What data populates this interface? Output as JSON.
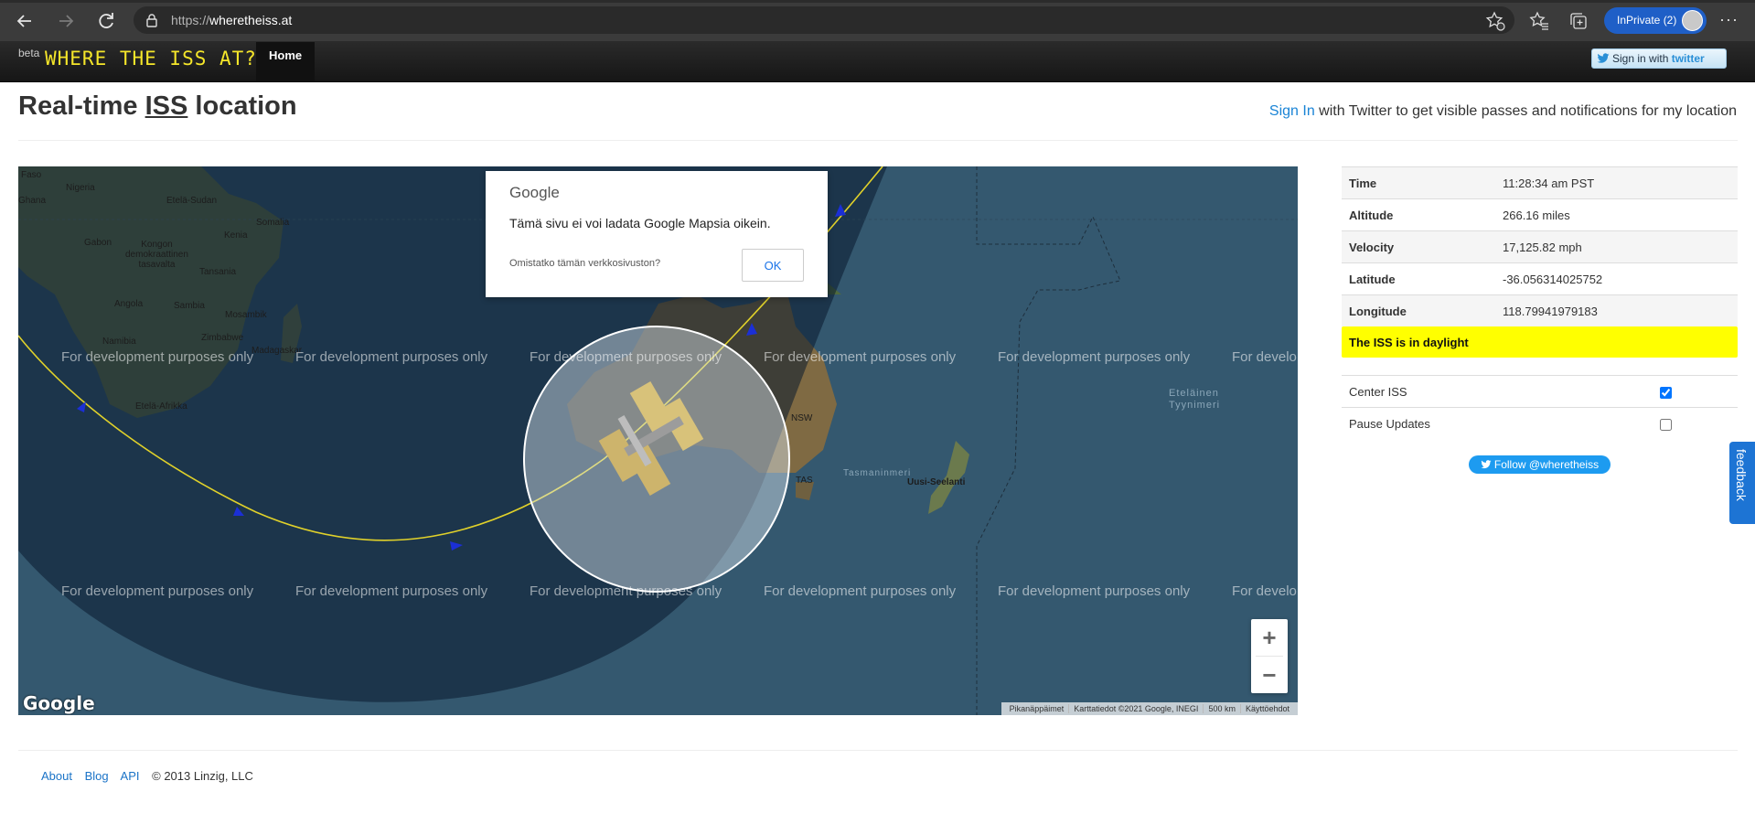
{
  "browser": {
    "url_prefix": "https://",
    "url_host": "wheretheiss.at",
    "inprivate_label": "InPrivate (2)",
    "icons": [
      "back-icon",
      "forward-icon",
      "refresh-icon",
      "lock-icon",
      "favorite-add-icon",
      "favorites-icon",
      "collections-icon",
      "more-icon"
    ]
  },
  "nav": {
    "beta": "beta",
    "brand": "WHERE THE ISS AT?",
    "home": "Home",
    "twitter_signin_prefix": "Sign in with",
    "twitter_signin_word": "twitter"
  },
  "header": {
    "title_pre": "Real-time ",
    "title_iss": "ISS",
    "title_post": " location",
    "signin_link": "Sign In",
    "signin_rest": " with Twitter to get visible passes and notifications for my location"
  },
  "map": {
    "watermark": "For development purposes only",
    "watermark_cut": "For develo",
    "dialog": {
      "brand": "Google",
      "message": "Tämä sivu ei voi ladata Google Mapsia oikein.",
      "own_question": "Omistatko tämän verkkosivuston?",
      "ok": "OK"
    },
    "labels": {
      "faso": "Faso",
      "nigeria": "Nigeria",
      "ghana": "Ghana",
      "ethiopia": "Etelä-Sudan",
      "somalia": "Somalia",
      "gabon": "Gabon",
      "kenia": "Kenia",
      "congo": "Kongon\ndemokraattinen\ntasavalta",
      "tansania": "Tansania",
      "angola": "Angola",
      "sambia": "Sambia",
      "mosambik": "Mosambik",
      "zimbabwe": "Zimbabwe",
      "namibia": "Namibia",
      "madagaskar": "Madagaskar",
      "safrica": "Etelä-Afrikka",
      "nsw": "NSW",
      "tas": "TAS",
      "nz": "Uusi-Seelanti",
      "pacific": "Eteläinen\nTyynimeri",
      "tasman": "Tasmaninmeri"
    },
    "zoom_in": "+",
    "zoom_out": "−",
    "google": "Google",
    "attribution": [
      "Pikanäppäimet",
      "Karttatiedot ©2021 Google, INEGI",
      "500 km",
      "Käyttöehdot"
    ]
  },
  "info": {
    "rows": [
      {
        "key": "Time",
        "value": "11:28:34 am PST"
      },
      {
        "key": "Altitude",
        "value": "266.16 miles"
      },
      {
        "key": "Velocity",
        "value": "17,125.82 mph"
      },
      {
        "key": "Latitude",
        "value": "-36.056314025752"
      },
      {
        "key": "Longitude",
        "value": "118.79941979183"
      }
    ],
    "daylight": "The ISS is in daylight",
    "center_iss": "Center ISS",
    "center_iss_checked": true,
    "pause_updates": "Pause Updates",
    "pause_updates_checked": false,
    "follow": "Follow @wheretheiss",
    "feedback": "feedback"
  },
  "footer": {
    "about": "About",
    "blog": "Blog",
    "api": "API",
    "copyright": "© 2013 Linzig, LLC"
  },
  "colors": {
    "nav_bg": "#1a1a1a",
    "brand_yellow": "#f5e62a",
    "link_blue": "#1a84d6",
    "daylight_yellow": "#ffff00",
    "twitter_blue": "#1d9bf0"
  }
}
